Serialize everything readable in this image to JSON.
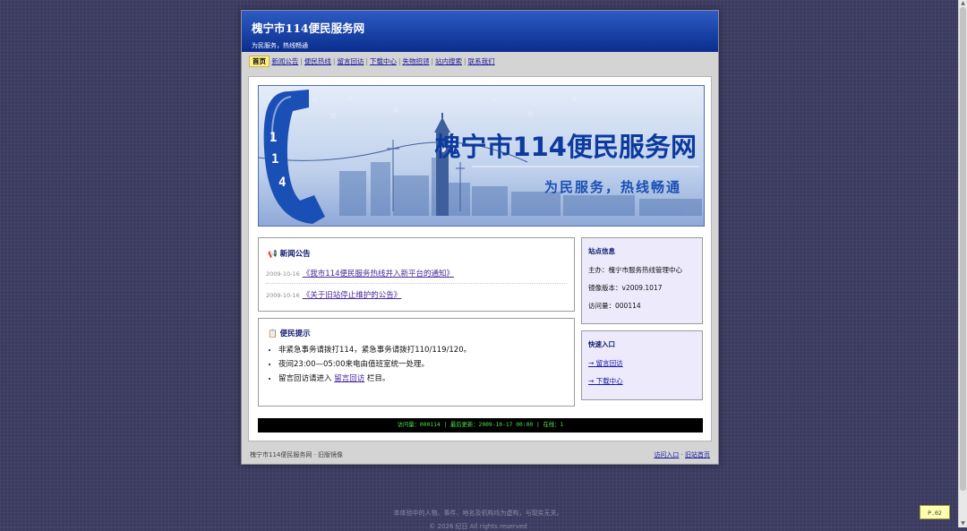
{
  "site": {
    "title": "槐宁市114便民服务网",
    "slogan": "为民服务，热线畅通"
  },
  "nav": {
    "items": [
      "首页",
      "新闻公告",
      "便民热线",
      "留言回访",
      "下载中心",
      "失物招领",
      "站内搜索",
      "联系我们"
    ],
    "active": "首页"
  },
  "banner": {
    "title": "槐宁市114便民服务网",
    "subtitle": "为民服务，热线畅通",
    "phone_digits": [
      "1",
      "1",
      "4"
    ]
  },
  "news": {
    "title": "新闻公告",
    "items": [
      {
        "date": "2009-10-16",
        "title": "《我市114便民服务热线并入新平台的通知》"
      },
      {
        "date": "2009-10-16",
        "title": "《关于旧站停止维护的公告》"
      }
    ]
  },
  "tips": {
    "title": "便民提示",
    "items": [
      "非紧急事务请拨打114，紧急事务请拨打110/119/120。",
      "夜间23:00—05:00来电由值班室统一处理。"
    ],
    "item3_prefix": "留言回访请进入 ",
    "item3_link": "留言回访",
    "item3_suffix": " 栏目。"
  },
  "station": {
    "title": "站点信息",
    "host": "主办：槐宁市服务热线管理中心",
    "version": "镜像版本：v2009.1017",
    "visits": "访问量：000114"
  },
  "quick": {
    "title": "快速入口",
    "links": [
      "→ 留言回访",
      "→ 下载中心"
    ]
  },
  "ticker": "访问量：000114  |  最后更新：2009-10-17 00:00  |  在线：1",
  "page_footer": {
    "left": "槐宁市114便民服务网 · 旧版镜像",
    "link1": "访问入口",
    "sep": " · ",
    "link2": "旧站首页"
  },
  "disclaimer": "本体验中的人物、事件、地名及机构均为虚构，与现实无关。",
  "copyright": "© 2026 纪日 All rights reserved",
  "page_badge": "P.02",
  "colors": {
    "background": "#3b3a5f",
    "header": "#0a2d8e",
    "link": "#1a1aa0",
    "ticker_text": "#4ee04e"
  }
}
